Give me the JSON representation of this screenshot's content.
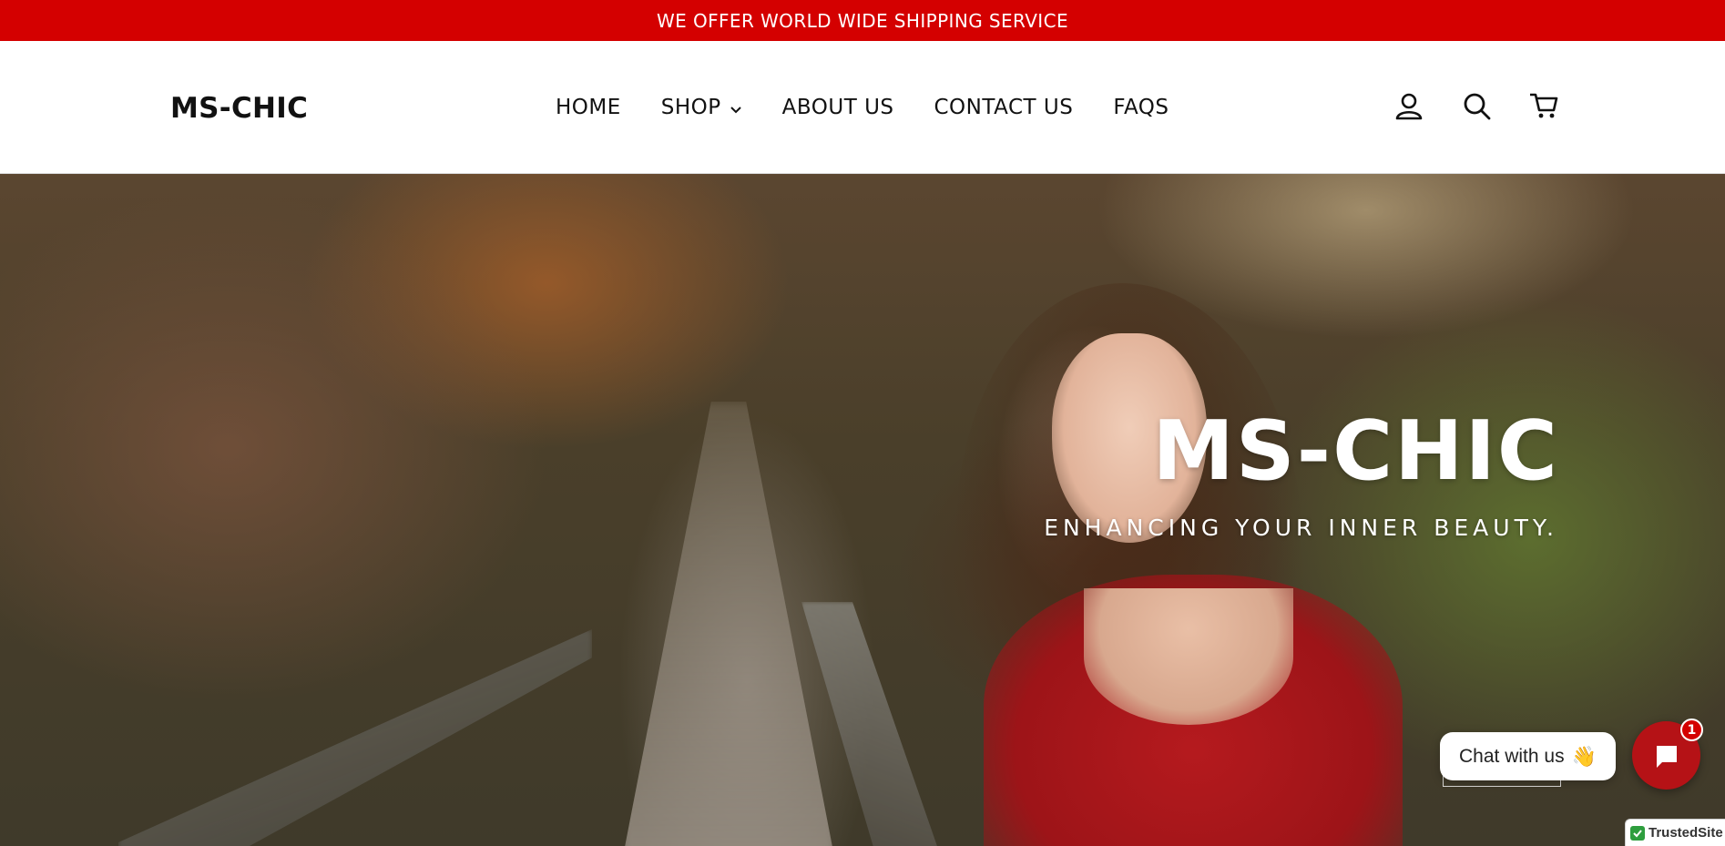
{
  "announcement": {
    "text": "WE OFFER WORLD WIDE SHIPPING SERVICE"
  },
  "header": {
    "logo": "MS-CHIC",
    "nav": [
      {
        "label": "HOME"
      },
      {
        "label": "SHOP"
      },
      {
        "label": "ABOUT US"
      },
      {
        "label": "CONTACT US"
      },
      {
        "label": "FAQS"
      }
    ],
    "icons": [
      "user-icon",
      "search-icon",
      "cart-icon"
    ]
  },
  "hero": {
    "title": "MS-CHIC",
    "subtitle": "ENHANCING YOUR INNER BEAUTY."
  },
  "chat": {
    "label": "Chat with us",
    "emoji": "👋",
    "badge_count": "1"
  },
  "trusted": {
    "label": "TrustedSite"
  },
  "colors": {
    "accent": "#d40000",
    "chat_button": "#b51216"
  }
}
